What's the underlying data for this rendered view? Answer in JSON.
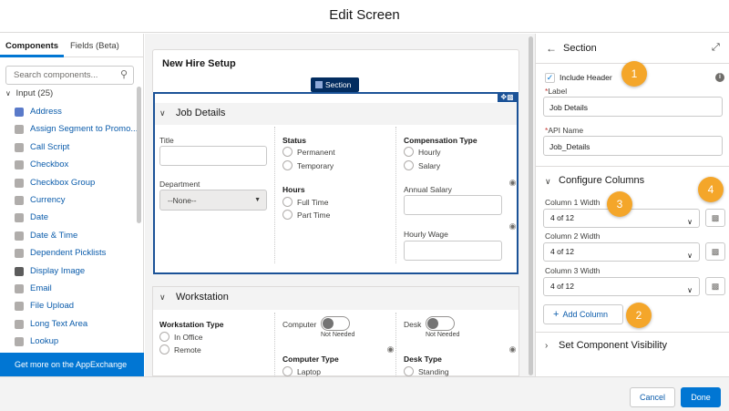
{
  "window": {
    "title": "Edit Screen"
  },
  "left_panel": {
    "tabs": [
      {
        "label": "Components"
      },
      {
        "label": "Fields (Beta)"
      }
    ],
    "search_placeholder": "Search components...",
    "group_label": "Input (25)",
    "components": [
      {
        "label": "Address",
        "icon": "address-icon",
        "color": "#5a7ac9"
      },
      {
        "label": "Assign Segment to Promo...",
        "icon": "assign-segment-icon",
        "color": "#8d9bb5"
      },
      {
        "label": "Call Script",
        "icon": "call-script-icon",
        "color": "#8d9bb5"
      },
      {
        "label": "Checkbox",
        "icon": "checkbox-icon",
        "color": "#8d9bb5"
      },
      {
        "label": "Checkbox Group",
        "icon": "checkbox-group-icon",
        "color": "#8d9bb5"
      },
      {
        "label": "Currency",
        "icon": "currency-icon",
        "color": "#8d9bb5"
      },
      {
        "label": "Date",
        "icon": "date-icon",
        "color": "#8d9bb5"
      },
      {
        "label": "Date & Time",
        "icon": "date-time-icon",
        "color": "#8d9bb5"
      },
      {
        "label": "Dependent Picklists",
        "icon": "dependent-picklists-icon",
        "color": "#8d9bb5"
      },
      {
        "label": "Display Image",
        "icon": "display-image-icon",
        "color": "#5c5c5c"
      },
      {
        "label": "Email",
        "icon": "email-icon",
        "color": "#8d9bb5"
      },
      {
        "label": "File Upload",
        "icon": "file-upload-icon",
        "color": "#8d9bb5"
      },
      {
        "label": "Long Text Area",
        "icon": "long-text-area-icon",
        "color": "#8d9bb5"
      },
      {
        "label": "Lookup",
        "icon": "lookup-icon",
        "color": "#8d9bb5"
      }
    ],
    "appexchange_label": "Get more on the AppExchange"
  },
  "canvas": {
    "screen_title": "New Hire Setup",
    "section_badge": "Section",
    "job_details": {
      "header": "Job Details",
      "title_label": "Title",
      "department_label": "Department",
      "department_value": "--None--",
      "status_label": "Status",
      "status_options": [
        "Permanent",
        "Temporary"
      ],
      "hours_label": "Hours",
      "hours_options": [
        "Full Time",
        "Part Time"
      ],
      "comp_type_label": "Compensation Type",
      "comp_type_options": [
        "Hourly",
        "Salary"
      ],
      "annual_salary_label": "Annual Salary",
      "hourly_wage_label": "Hourly Wage"
    },
    "workstation": {
      "header": "Workstation",
      "type_label": "Workstation Type",
      "type_options": [
        "In Office",
        "Remote"
      ],
      "computer_label": "Computer",
      "computer_state": "Not Needed",
      "desk_label": "Desk",
      "desk_state": "Not Needed",
      "computer_type_label": "Computer Type",
      "computer_type_options": [
        "Laptop"
      ],
      "desk_type_label": "Desk Type",
      "desk_type_options": [
        "Standing"
      ]
    }
  },
  "right_panel": {
    "title": "Section",
    "include_header_label": "Include Header",
    "include_header_checked": true,
    "label_label": "Label",
    "label_value": "Job Details",
    "api_name_label": "API Name",
    "api_name_value": "Job_Details",
    "configure_columns_label": "Configure Columns",
    "columns": [
      {
        "label": "Column 1 Width",
        "value": "4 of 12"
      },
      {
        "label": "Column 2 Width",
        "value": "4 of 12"
      },
      {
        "label": "Column 3 Width",
        "value": "4 of 12"
      }
    ],
    "add_column_label": "Add Column",
    "visibility_label": "Set Component Visibility"
  },
  "callouts": [
    "1",
    "2",
    "3",
    "4"
  ],
  "footer": {
    "cancel_label": "Cancel",
    "done_label": "Done"
  },
  "colors": {
    "brand": "#0176d3",
    "callout": "#f4a62a",
    "link": "#0b5cab"
  }
}
